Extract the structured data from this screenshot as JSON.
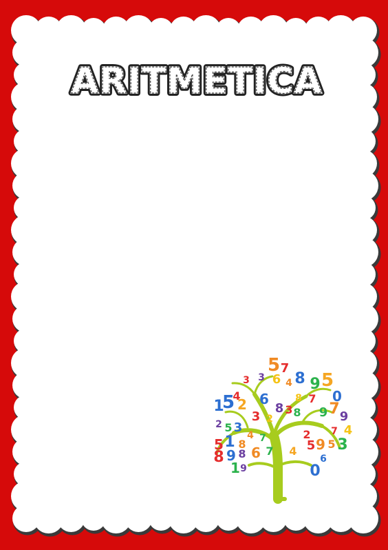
{
  "page": {
    "title": "ARITMETICA"
  },
  "colors": {
    "frame": "#d60a0a",
    "paper": "#ffffff",
    "trunk": "#a7cc1e",
    "outline": "#222222"
  },
  "tree": {
    "numbers": [
      {
        "t": "5",
        "c": "#f08a24"
      },
      {
        "t": "7",
        "c": "#e52d2d"
      },
      {
        "t": "3",
        "c": "#6b3fa0"
      },
      {
        "t": "6",
        "c": "#f5c316"
      },
      {
        "t": "8",
        "c": "#2d6fd1"
      },
      {
        "t": "9",
        "c": "#2bb24c"
      },
      {
        "t": "5",
        "c": "#f5a623"
      },
      {
        "t": "3",
        "c": "#e52d2d"
      },
      {
        "t": "4",
        "c": "#f08a24"
      },
      {
        "t": "1",
        "c": "#2d6fd1"
      },
      {
        "t": "5",
        "c": "#2d6fd1"
      },
      {
        "t": "2",
        "c": "#f5a623"
      },
      {
        "t": "4",
        "c": "#e52d2d"
      },
      {
        "t": "6",
        "c": "#2d6fd1"
      },
      {
        "t": "8",
        "c": "#6b3fa0"
      },
      {
        "t": "3",
        "c": "#e52d2d"
      },
      {
        "t": "2",
        "c": "#f5c316"
      },
      {
        "t": "8",
        "c": "#2bb24c"
      },
      {
        "t": "7",
        "c": "#e52d2d"
      },
      {
        "t": "0",
        "c": "#2d6fd1"
      },
      {
        "t": "9",
        "c": "#2bb24c"
      },
      {
        "t": "7",
        "c": "#f08a24"
      },
      {
        "t": "8",
        "c": "#f5c316"
      },
      {
        "t": "3",
        "c": "#e52d2d"
      },
      {
        "t": "2",
        "c": "#6b3fa0"
      },
      {
        "t": "5",
        "c": "#2bb24c"
      },
      {
        "t": "3",
        "c": "#2d6fd1"
      },
      {
        "t": "4",
        "c": "#f08a24"
      },
      {
        "t": "7",
        "c": "#2bb24c"
      },
      {
        "t": "5",
        "c": "#e52d2d"
      },
      {
        "t": "1",
        "c": "#2d6fd1"
      },
      {
        "t": "8",
        "c": "#f08a24"
      },
      {
        "t": "9",
        "c": "#6b3fa0"
      },
      {
        "t": "4",
        "c": "#f5c316"
      },
      {
        "t": "7",
        "c": "#e52d2d"
      },
      {
        "t": "5",
        "c": "#f08a24"
      },
      {
        "t": "8",
        "c": "#e52d2d"
      },
      {
        "t": "9",
        "c": "#2d6fd1"
      },
      {
        "t": "8",
        "c": "#6b3fa0"
      },
      {
        "t": "6",
        "c": "#f08a24"
      },
      {
        "t": "7",
        "c": "#2bb24c"
      },
      {
        "t": "5",
        "c": "#e52d2d"
      },
      {
        "t": "9",
        "c": "#f08a24"
      },
      {
        "t": "3",
        "c": "#2bb24c"
      },
      {
        "t": "0",
        "c": "#2d6fd1"
      },
      {
        "t": "6",
        "c": "#2d6fd1"
      },
      {
        "t": "1",
        "c": "#2bb24c"
      },
      {
        "t": "9",
        "c": "#6b3fa0"
      },
      {
        "t": "4",
        "c": "#f5a623"
      },
      {
        "t": "2",
        "c": "#e52d2d"
      }
    ]
  }
}
